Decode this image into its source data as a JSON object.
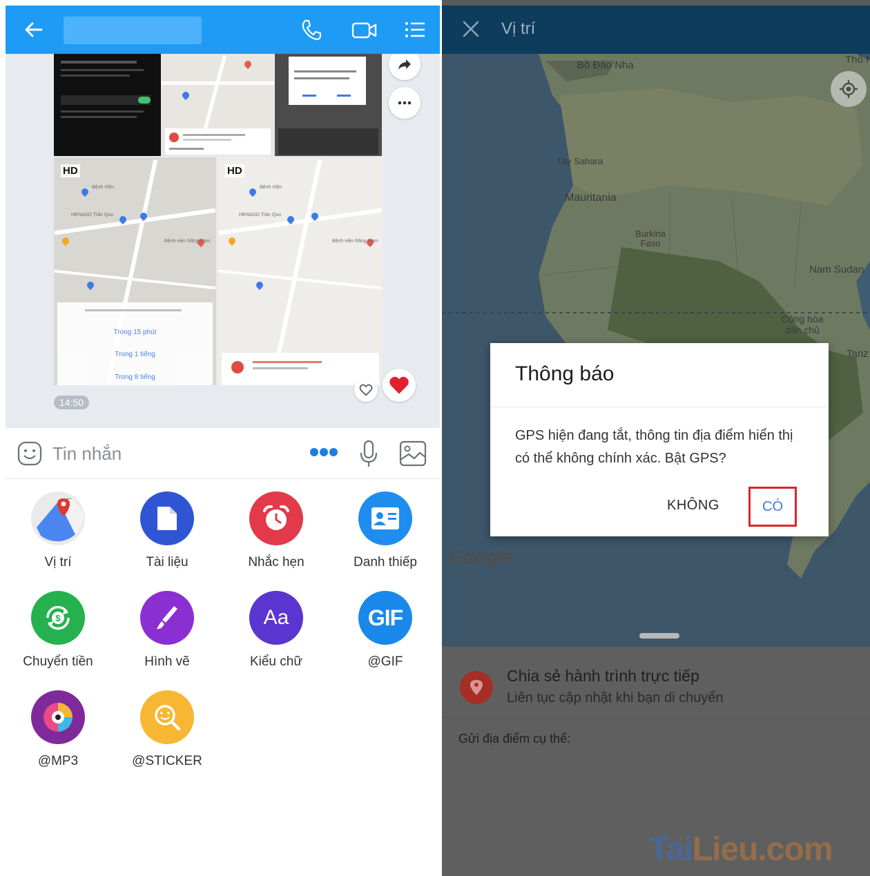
{
  "left": {
    "chat": {
      "badge_hd_1": "HD",
      "badge_hd_2": "HD",
      "share_options": [
        "Trong 15 phút",
        "Trong 1 tiếng",
        "Trong 8 tiếng"
      ],
      "timestamp": "14:50"
    },
    "composer": {
      "placeholder": "Tin nhắn"
    },
    "attach_grid": [
      {
        "label": "Vị trí",
        "icon": "location-icon"
      },
      {
        "label": "Tài liệu",
        "icon": "document-icon"
      },
      {
        "label": "Nhắc hẹn",
        "icon": "alarm-clock-icon"
      },
      {
        "label": "Danh thiếp",
        "icon": "contact-card-icon"
      },
      {
        "label": "Chuyển tiền",
        "icon": "money-transfer-icon"
      },
      {
        "label": "Hình vẽ",
        "icon": "brush-icon"
      },
      {
        "label": "Kiểu chữ",
        "icon": "text-style-icon"
      },
      {
        "label": "@GIF",
        "icon": "gif-icon"
      },
      {
        "label": "@MP3",
        "icon": "music-disc-icon"
      },
      {
        "label": "@STICKER",
        "icon": "sticker-icon"
      }
    ],
    "text_style_glyph": "Aa",
    "gif_glyph": "GIF"
  },
  "right": {
    "title": "Vị trí",
    "map_labels": {
      "portugal": "Bồ Đào Nha",
      "western_sahara": "Tây Sahara",
      "mauritania": "Mauritania",
      "burkina": "Burkina Faso",
      "south_sudan": "Nam Sudan",
      "congo": "Cộng hòa dân chủ",
      "tanz": "Tanz",
      "tho": "Thổ N"
    },
    "map_attribution": "Google",
    "dialog": {
      "title": "Thông báo",
      "message": "GPS hiện đang tắt, thông tin địa điểm hiển thị có thể không chính xác. Bật GPS?",
      "no_label": "KHÔNG",
      "yes_label": "CÓ"
    },
    "share": {
      "title": "Chia sẻ hành trình trực tiếp",
      "subtitle": "Liên tục cập nhật khi bạn di chuyển"
    },
    "send_section": "Gửi địa điểm cụ thể:",
    "watermark_a": "Tai",
    "watermark_b": "Lieu",
    "watermark_c": ".com"
  },
  "colors": {
    "zalo_blue": "#1e9bf5",
    "highlight_red": "#d7262f"
  }
}
